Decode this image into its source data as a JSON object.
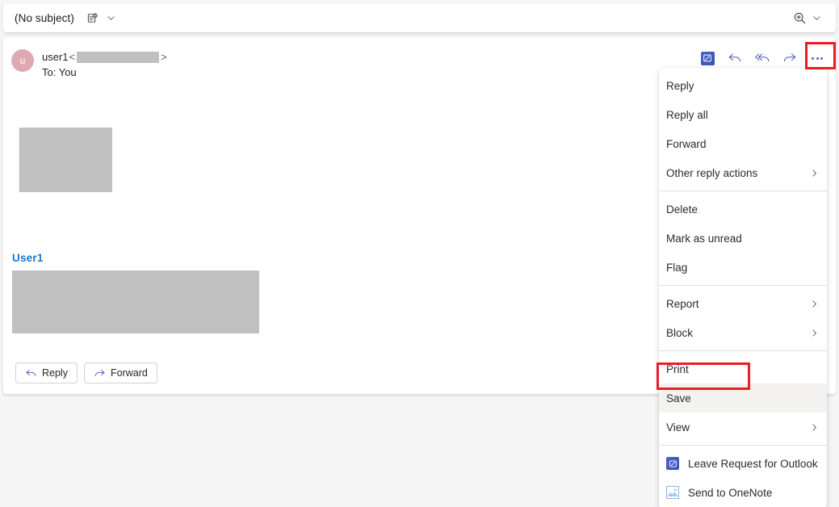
{
  "header": {
    "subject": "(No subject)",
    "subject_icon": "message-badge-icon",
    "subject_chevron_icon": "chevron-down-icon",
    "zoom_icon": "zoom-in-icon",
    "zoom_chevron_icon": "chevron-down-icon"
  },
  "message": {
    "avatar_initial": "u",
    "avatar_color": "#deaab2",
    "sender_name": "user1",
    "email_open_bracket": "<",
    "email_close_bracket": ">",
    "recipients": "To: You",
    "signature_name": "User1",
    "signature_color": "#1379d6",
    "toolbar": [
      {
        "name": "leave-request-addin-icon",
        "label": "Leave Request for Outlook"
      },
      {
        "name": "reply-icon",
        "label": "Reply"
      },
      {
        "name": "reply-all-icon",
        "label": "Reply all"
      },
      {
        "name": "forward-icon",
        "label": "Forward"
      },
      {
        "name": "more-options-icon",
        "label": "More options"
      }
    ]
  },
  "footer_actions": [
    {
      "label": "Reply",
      "icon": "reply-icon"
    },
    {
      "label": "Forward",
      "icon": "forward-icon"
    }
  ],
  "context_menu": {
    "items": [
      {
        "label": "Reply",
        "submenu": false,
        "icon": null,
        "separator_after": false,
        "hovered": false
      },
      {
        "label": "Reply all",
        "submenu": false,
        "icon": null,
        "separator_after": false,
        "hovered": false
      },
      {
        "label": "Forward",
        "submenu": false,
        "icon": null,
        "separator_after": false,
        "hovered": false
      },
      {
        "label": "Other reply actions",
        "submenu": true,
        "icon": null,
        "separator_after": true,
        "hovered": false
      },
      {
        "label": "Delete",
        "submenu": false,
        "icon": null,
        "separator_after": false,
        "hovered": false
      },
      {
        "label": "Mark as unread",
        "submenu": false,
        "icon": null,
        "separator_after": false,
        "hovered": false
      },
      {
        "label": "Flag",
        "submenu": false,
        "icon": null,
        "separator_after": true,
        "hovered": false
      },
      {
        "label": "Report",
        "submenu": true,
        "icon": null,
        "separator_after": false,
        "hovered": false
      },
      {
        "label": "Block",
        "submenu": true,
        "icon": null,
        "separator_after": true,
        "hovered": false
      },
      {
        "label": "Print",
        "submenu": false,
        "icon": null,
        "separator_after": false,
        "hovered": false
      },
      {
        "label": "Save",
        "submenu": false,
        "icon": null,
        "separator_after": false,
        "hovered": true
      },
      {
        "label": "View",
        "submenu": true,
        "icon": null,
        "separator_after": true,
        "hovered": false
      },
      {
        "label": "Leave Request for Outlook",
        "submenu": false,
        "icon": "leave-request-addin-icon",
        "separator_after": false,
        "hovered": false
      },
      {
        "label": "Send to OneNote",
        "submenu": false,
        "icon": "onenote-icon",
        "separator_after": false,
        "hovered": false
      }
    ]
  },
  "highlights": {
    "color": "#ec1c24",
    "targets": [
      "more-options-button",
      "save-menu-item"
    ]
  }
}
